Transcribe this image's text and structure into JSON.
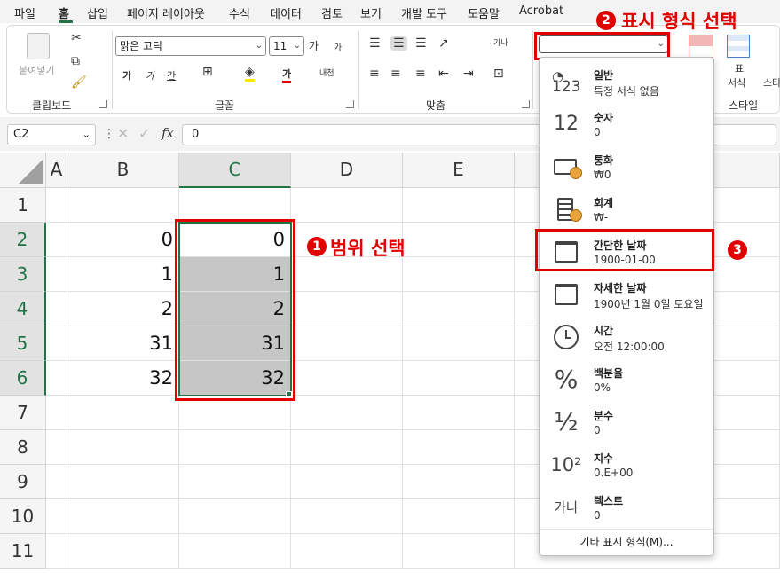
{
  "menu": {
    "items": [
      "파일",
      "홈",
      "삽입",
      "페이지 레이아웃",
      "수식",
      "데이터",
      "검토",
      "보기",
      "개발 도구",
      "도움말",
      "Acrobat"
    ]
  },
  "ribbon": {
    "clipboard": {
      "paste_label": "붙여넣기",
      "group_label": "클립보드"
    },
    "font": {
      "font_name": "맑은 고딕",
      "font_size": "11",
      "grow": "가",
      "shrink": "가",
      "bold": "가",
      "italic": "가",
      "underline": "간",
      "font_color": "가",
      "phonetic": "내천",
      "group_label": "글꼴"
    },
    "alignment": {
      "wrap": "가나",
      "group_label": "맞춤"
    },
    "number": {
      "format_value": ""
    },
    "styles": {
      "table_format": "표",
      "table_format2": "서식",
      "cell_styles": "스타",
      "group_label": "스타일"
    }
  },
  "formula_bar": {
    "name_box": "C2",
    "fx": "fx",
    "value": "0"
  },
  "sheet": {
    "columns": [
      "A",
      "B",
      "C",
      "D",
      "E"
    ],
    "rows": [
      "1",
      "2",
      "3",
      "4",
      "5",
      "6",
      "7",
      "8",
      "9",
      "10",
      "11"
    ],
    "col_b": [
      "",
      "0",
      "1",
      "2",
      "31",
      "32",
      "",
      "",
      "",
      "",
      ""
    ],
    "col_c": [
      "",
      "0",
      "1",
      "2",
      "31",
      "32",
      "",
      "",
      "",
      "",
      ""
    ]
  },
  "annotations": {
    "step1": {
      "num": "1",
      "text": "범위 선택"
    },
    "step2": {
      "num": "2",
      "text": "표시 형식 선택"
    },
    "step3": {
      "num": "3"
    }
  },
  "format_dropdown": {
    "items": [
      {
        "name": "일반",
        "sample": "특정 서식 없음",
        "icon": "general-format-icon"
      },
      {
        "name": "숫자",
        "sample": "0",
        "icon": "number-format-icon"
      },
      {
        "name": "통화",
        "sample": "₩0",
        "icon": "currency-format-icon"
      },
      {
        "name": "회계",
        "sample": "₩-",
        "icon": "accounting-format-icon"
      },
      {
        "name": "간단한 날짜",
        "sample": "1900-01-00",
        "icon": "calendar-icon"
      },
      {
        "name": "자세한 날짜",
        "sample": "1900년 1월 0일 토요일",
        "icon": "calendar-icon"
      },
      {
        "name": "시간",
        "sample": "오전 12:00:00",
        "icon": "clock-icon"
      },
      {
        "name": "백분율",
        "sample": "0%",
        "icon": "percent-icon"
      },
      {
        "name": "분수",
        "sample": "0",
        "icon": "fraction-icon"
      },
      {
        "name": "지수",
        "sample": "0.E+00",
        "icon": "scientific-icon"
      },
      {
        "name": "텍스트",
        "sample": "0",
        "icon": "text-format-icon"
      }
    ],
    "icon_text": {
      "general_top": "123",
      "number": "12",
      "fraction": "½",
      "sci": "10²",
      "text": "가나",
      "percent": "%"
    },
    "more": "기타 표시 형식(M)..."
  },
  "colors": {
    "accent": "#217346",
    "annotation": "#e00000",
    "selection": "#c6c6c6"
  }
}
